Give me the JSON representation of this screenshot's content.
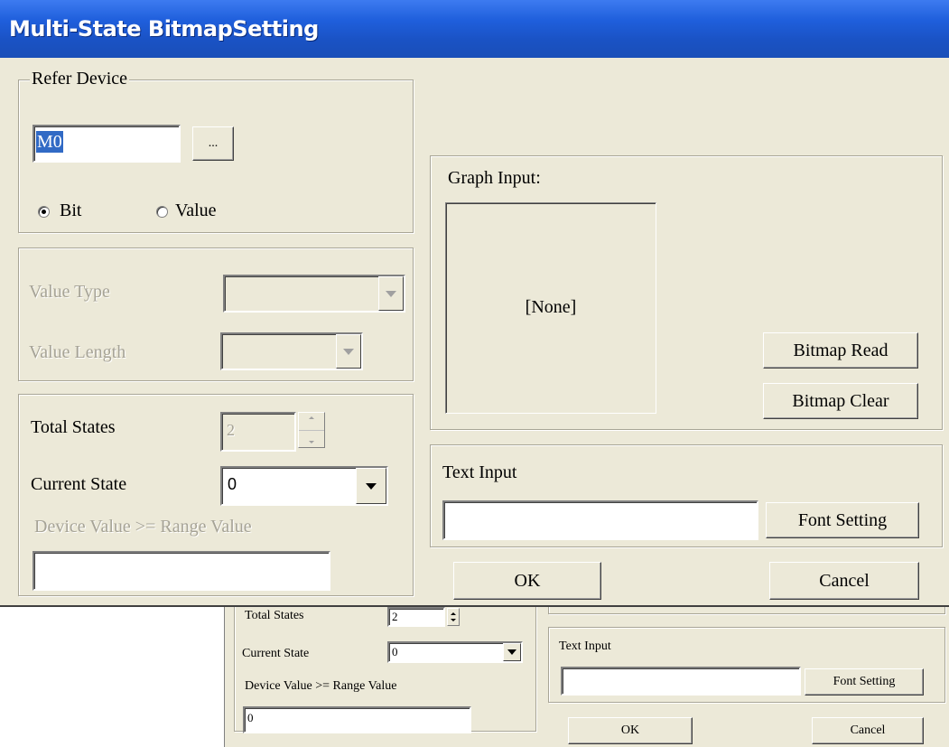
{
  "window": {
    "title": "Multi-State BitmapSetting"
  },
  "refer_device": {
    "label": "Refer Device",
    "device_value": "M0",
    "browse_label": "...",
    "radio_bit": "Bit",
    "radio_value": "Value",
    "selected": "Bit"
  },
  "value_group": {
    "value_type_label": "Value Type",
    "value_type_value": "",
    "value_length_label": "Value Length",
    "value_length_value": ""
  },
  "states": {
    "total_label": "Total States",
    "total_value": "2",
    "current_label": "Current State",
    "current_value": "0",
    "range_label": "Device Value >= Range Value",
    "range_value": ""
  },
  "graph": {
    "label": "Graph Input:",
    "preview_text": "[None]",
    "read_label": "Bitmap Read",
    "clear_label": "Bitmap Clear"
  },
  "text_input": {
    "label": "Text Input",
    "value": "",
    "font_label": "Font Setting"
  },
  "buttons": {
    "ok": "OK",
    "cancel": "Cancel"
  },
  "back_window": {
    "total_label": "Total States",
    "total_value": "2",
    "current_label": "Current State",
    "current_value": "0",
    "range_label": "Device Value >= Range Value",
    "range_value": "0",
    "text_input_label": "Text Input",
    "font_label": "Font Setting",
    "ok": "OK",
    "cancel": "Cancel"
  },
  "colors": {
    "titlebar": "#2a62d8",
    "face": "#ece9d8",
    "selection": "#316ac5"
  }
}
